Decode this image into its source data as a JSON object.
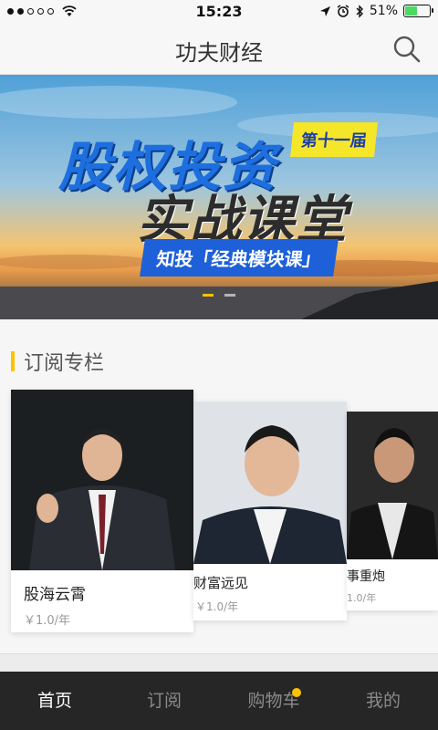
{
  "status_bar": {
    "time": "15:23",
    "battery_text": "51%",
    "battery_level": 0.51
  },
  "header": {
    "title": "功夫财经"
  },
  "banner": {
    "line1": "股权投资",
    "badge": "第十一届",
    "line2": "实战课堂",
    "subtitle": "知投「经典模块课」",
    "page_count": 2,
    "active_page": 0
  },
  "section": {
    "title": "订阅专栏",
    "cards": [
      {
        "name": "股海云霄",
        "price": "￥1.0/年"
      },
      {
        "name": "财富远见",
        "price": "￥1.0/年"
      },
      {
        "name": "事重炮",
        "price": "1.0/年"
      }
    ]
  },
  "tabs": [
    {
      "label": "首页",
      "active": true
    },
    {
      "label": "订阅",
      "active": false
    },
    {
      "label": "购物车",
      "active": false,
      "badge_dot": true
    },
    {
      "label": "我的",
      "active": false
    }
  ],
  "colors": {
    "accent": "#ffc200",
    "tabbar_bg": "#262626",
    "banner_blue": "#1d6fe0"
  }
}
